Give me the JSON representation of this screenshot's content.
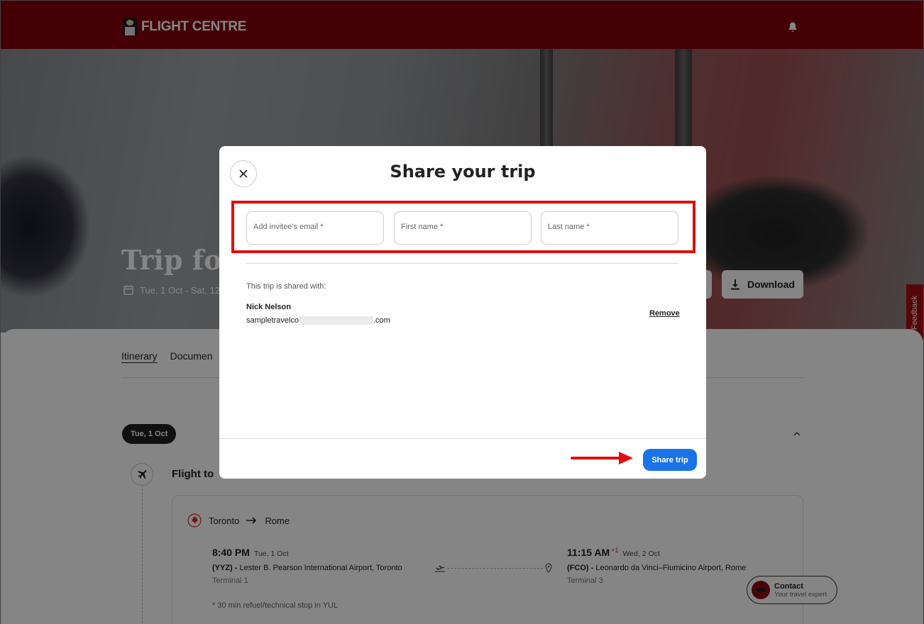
{
  "header": {
    "brand": "FLIGHT CENTRE",
    "notification_icon": "bell-icon"
  },
  "hero": {
    "title": "Trip for",
    "dates": "Tue, 1 Oct - Sat, 12",
    "download_label": "Download"
  },
  "feedback_label": "Feedback",
  "tabs": [
    {
      "label": "Itinerary",
      "active": true
    },
    {
      "label": "Documen",
      "active": false
    }
  ],
  "itinerary": {
    "day_label": "Tue, 1 Oct",
    "flight_title": "Flight to",
    "route": {
      "from": "Toronto",
      "to": "Rome"
    },
    "departure": {
      "time": "8:40 PM",
      "day": "Tue, 1 Oct",
      "code": "(YYZ) -",
      "airport": "Lester B. Pearson International Airport, Toronto",
      "terminal": "Terminal 1"
    },
    "arrival": {
      "time": "11:15 AM",
      "day_offset": "+1",
      "day": "Wed, 2 Oct",
      "code": "(FCO) -",
      "airport": "Leonardo da Vinci–Fiumicino Airport, Rome",
      "terminal": "Terminal 3"
    },
    "stop_note": "* 30 min refuel/technical stop in YUL"
  },
  "contact": {
    "title": "Contact",
    "subtitle": "Your travel expert"
  },
  "modal": {
    "title": "Share your trip",
    "email_placeholder": "Add invitee's email *",
    "first_name_placeholder": "First name *",
    "last_name_placeholder": "Last name *",
    "shared_with_label": "This trip is shared with:",
    "invitee": {
      "name": "Nick Nelson",
      "email_prefix": "sampletravelco",
      "email_suffix": ".com"
    },
    "remove_label": "Remove",
    "share_button": "Share trip"
  },
  "colors": {
    "brand_red": "#820008",
    "primary_blue": "#1a73e8",
    "highlight_red": "#e01010"
  }
}
